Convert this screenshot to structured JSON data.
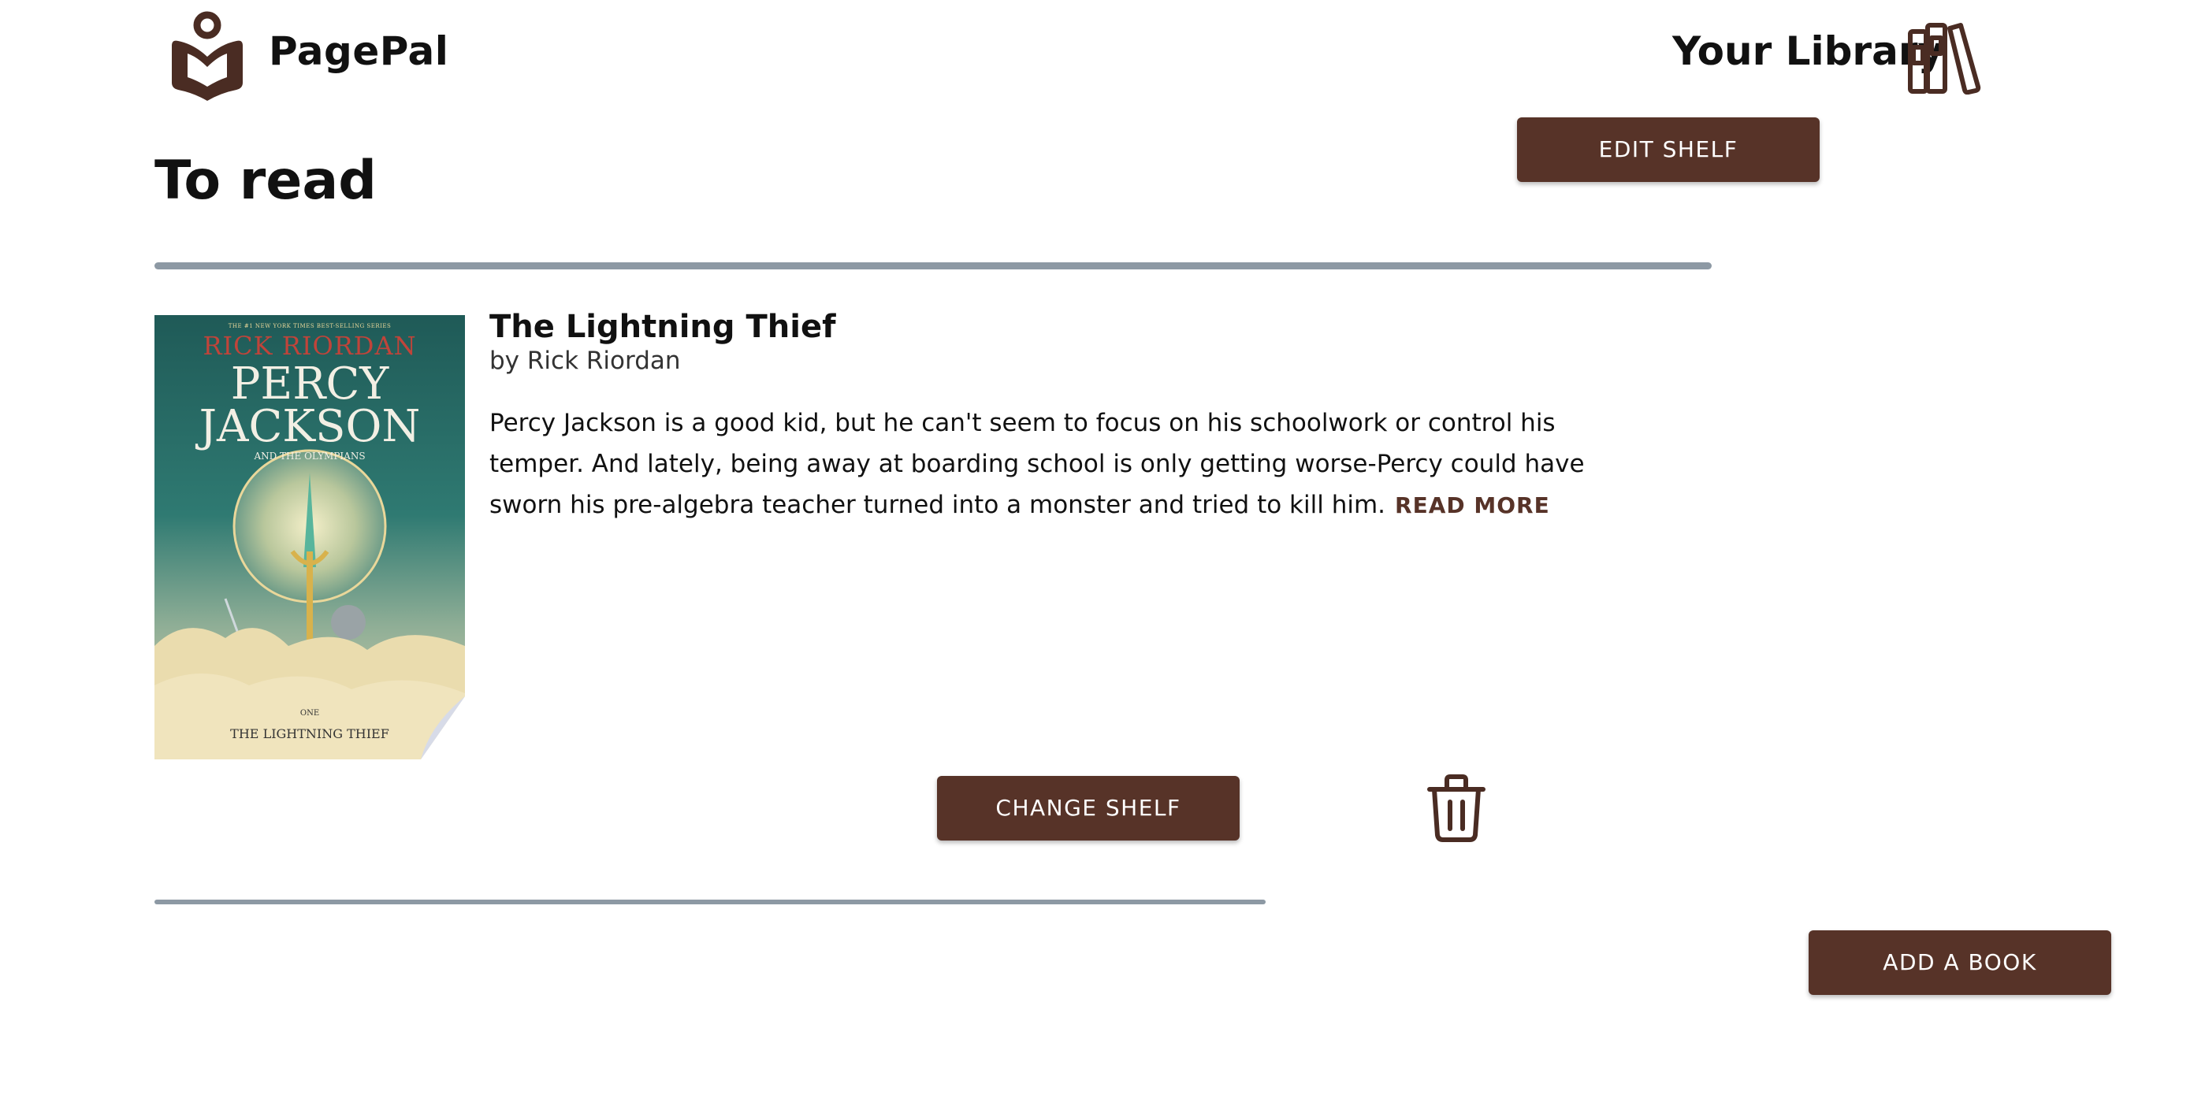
{
  "header": {
    "app_name": "PagePal",
    "library_label": "Your Library"
  },
  "shelf": {
    "title": "To read",
    "edit_button": "EDIT SHELF"
  },
  "book": {
    "title": "The Lightning Thief",
    "author": "by Rick Riordan",
    "description": "Percy Jackson is a good kid, but he can't seem to focus on his schoolwork or control his temper. And lately, being away at boarding school is only getting worse-Percy could have sworn his pre-algebra teacher turned into a monster and tried to kill him.",
    "read_more": "READ MORE",
    "change_shelf_button": "CHANGE SHELF",
    "cover": {
      "tagline": "THE #1 NEW YORK TIMES BEST-SELLING SERIES",
      "author": "RICK RIORDAN",
      "series_line1": "PERCY",
      "series_line2": "JACKSON",
      "series_sub": "AND THE OLYMPIANS",
      "volume": "ONE",
      "title": "THE LIGHTNING THIEF"
    }
  },
  "footer": {
    "add_button": "ADD A BOOK"
  },
  "colors": {
    "accent": "#573328",
    "divider": "#8d99a4",
    "background": "#ffffff"
  },
  "icons": {
    "logo": "book-heart-logo-icon",
    "library": "books-on-shelf-icon",
    "delete": "trash-icon"
  }
}
